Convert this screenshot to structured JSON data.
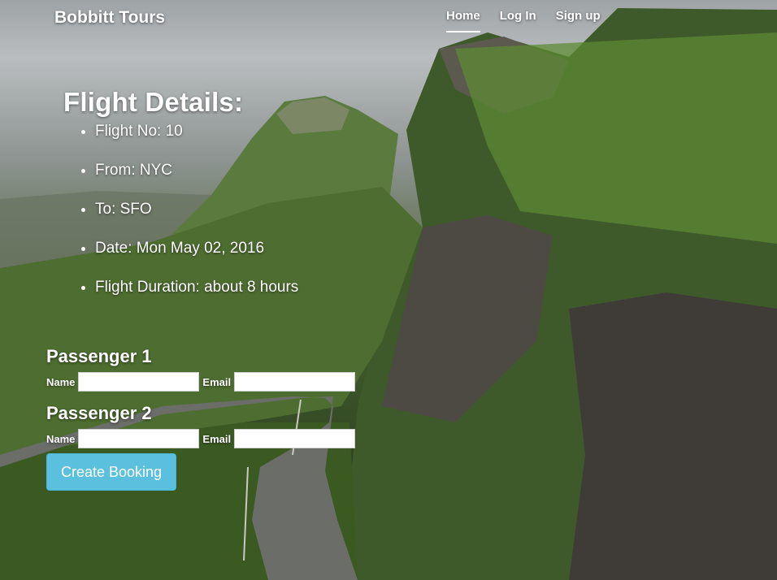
{
  "nav": {
    "brand": "Bobbitt Tours",
    "links": [
      {
        "label": "Home",
        "active": true
      },
      {
        "label": "Log In",
        "active": false
      },
      {
        "label": "Sign up",
        "active": false
      }
    ]
  },
  "flight": {
    "heading": "Flight Details:",
    "items": [
      "Flight No: 10",
      "From: NYC",
      "To: SFO",
      "Date: Mon May 02, 2016",
      "Flight Duration: about 8 hours"
    ]
  },
  "booking": {
    "passengers": [
      {
        "title": "Passenger 1",
        "name_label": "Name",
        "name_value": "",
        "email_label": "Email",
        "email_value": ""
      },
      {
        "title": "Passenger 2",
        "name_label": "Name",
        "name_value": "",
        "email_label": "Email",
        "email_value": ""
      }
    ],
    "submit_label": "Create Booking"
  },
  "colors": {
    "button": "#5bc0de",
    "text": "#ffffff"
  }
}
